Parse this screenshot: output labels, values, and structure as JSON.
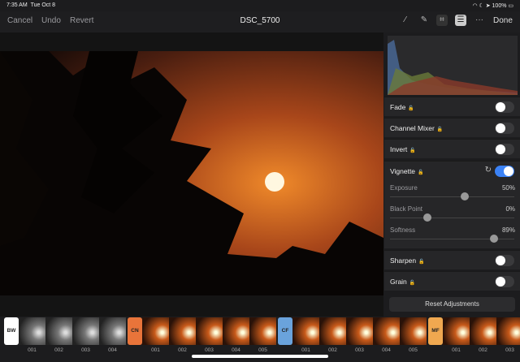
{
  "status": {
    "time": "7:35 AM",
    "date": "Tue Oct 8",
    "battery": "100%"
  },
  "toolbar": {
    "cancel": "Cancel",
    "undo": "Undo",
    "revert": "Revert",
    "title": "DSC_5700",
    "done": "Done",
    "icons": [
      "ml-wand-icon",
      "bandage-icon",
      "crop-icon",
      "adjustments-icon",
      "more-icon"
    ]
  },
  "panel": {
    "rows": [
      {
        "label": "Fade",
        "on": false
      },
      {
        "label": "Channel Mixer",
        "on": false
      },
      {
        "label": "Invert",
        "on": false
      }
    ],
    "vignette": {
      "label": "Vignette",
      "on": true,
      "sliders": [
        {
          "label": "Exposure",
          "value": "50%",
          "pos": 0.5
        },
        {
          "label": "Black Point",
          "value": "0%",
          "pos": 0.0
        },
        {
          "label": "Softness",
          "value": "89%",
          "pos": 0.89
        }
      ]
    },
    "rows2": [
      {
        "label": "Sharpen",
        "on": false
      },
      {
        "label": "Grain",
        "on": false
      }
    ],
    "reset": "Reset Adjustments"
  },
  "filmstrip": [
    {
      "label": "BW",
      "color": "#ffffff",
      "items": [
        "001",
        "002",
        "003",
        "004"
      ],
      "tone": "gray"
    },
    {
      "label": "CN",
      "color": "#e8743a",
      "items": [
        "001",
        "002",
        "003",
        "004",
        "005"
      ],
      "tone": "orange"
    },
    {
      "label": "CF",
      "color": "#6aa3dc",
      "items": [
        "001",
        "002",
        "003",
        "004",
        "005"
      ],
      "tone": "orange"
    },
    {
      "label": "MF",
      "color": "#f0a850",
      "items": [
        "001",
        "002",
        "003"
      ],
      "tone": "orange"
    }
  ]
}
